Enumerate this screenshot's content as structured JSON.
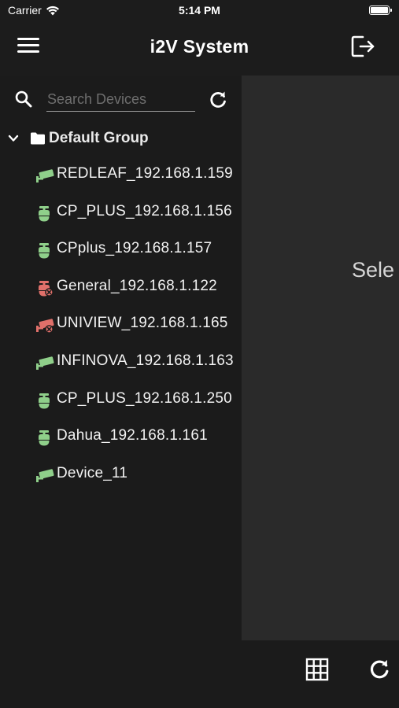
{
  "status_bar": {
    "carrier": "Carrier",
    "time": "5:14 PM"
  },
  "nav": {
    "title": "i2V System",
    "menu_icon": "hamburger-menu-icon",
    "logout_icon": "logout-icon"
  },
  "search": {
    "placeholder": "Search Devices",
    "value": ""
  },
  "group": {
    "label": "Default Group",
    "expanded": true
  },
  "devices": [
    {
      "label": "REDLEAF_192.168.1.159",
      "type": "bullet-camera",
      "status": "online"
    },
    {
      "label": "CP_PLUS_192.168.1.156",
      "type": "ptz-camera",
      "status": "online"
    },
    {
      "label": "CPplus_192.168.1.157",
      "type": "ptz-camera",
      "status": "online"
    },
    {
      "label": "General_192.168.1.122",
      "type": "ptz-camera",
      "status": "offline"
    },
    {
      "label": "UNIVIEW_192.168.1.165",
      "type": "bullet-camera",
      "status": "offline"
    },
    {
      "label": "INFINOVA_192.168.1.163",
      "type": "bullet-camera",
      "status": "online"
    },
    {
      "label": "CP_PLUS_192.168.1.250",
      "type": "ptz-camera",
      "status": "online"
    },
    {
      "label": "Dahua_192.168.1.161",
      "type": "ptz-camera",
      "status": "online"
    },
    {
      "label": "Device_11",
      "type": "bullet-camera",
      "status": "online"
    }
  ],
  "detail": {
    "message": "Sele"
  },
  "colors": {
    "online": "#8fcf8a",
    "offline": "#e0706a",
    "background": "#1c1c1c",
    "detail_background": "#2a2a2a"
  }
}
